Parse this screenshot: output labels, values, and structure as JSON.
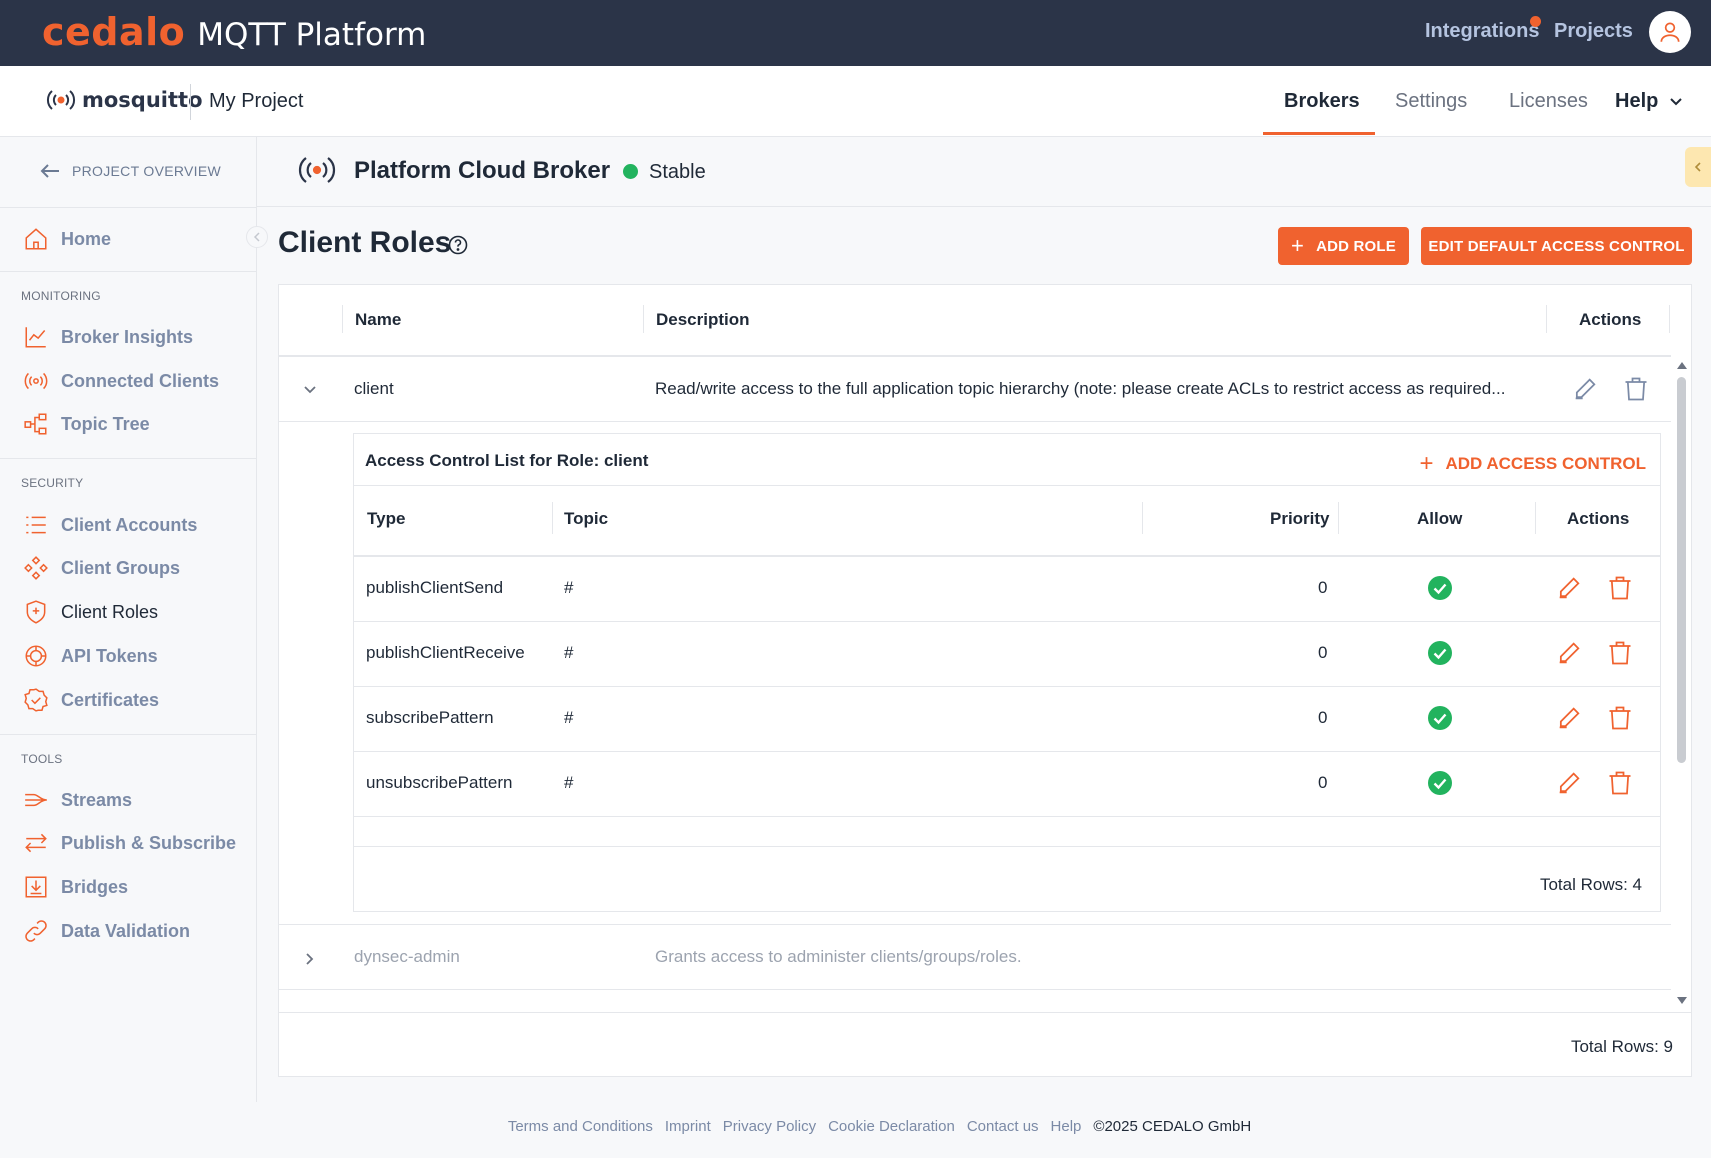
{
  "topbar": {
    "brand": "cedalo",
    "product": "MQTT Platform",
    "integrations": "Integrations",
    "projects": "Projects"
  },
  "subbar": {
    "logo_text": "mosquitto",
    "project_name": "My Project",
    "tabs": [
      "Brokers",
      "Settings",
      "Licenses",
      "Help"
    ],
    "active_tab": "Brokers"
  },
  "sidebar": {
    "project_overview": "PROJECT OVERVIEW",
    "home": "Home",
    "sections": {
      "monitoring": "MONITORING",
      "security": "SECURITY",
      "tools": "TOOLS"
    },
    "monitoring_items": [
      "Broker Insights",
      "Connected Clients",
      "Topic Tree"
    ],
    "security_items": [
      "Client Accounts",
      "Client Groups",
      "Client Roles",
      "API Tokens",
      "Certificates"
    ],
    "tools_items": [
      "Streams",
      "Publish & Subscribe",
      "Bridges",
      "Data Validation"
    ],
    "active_item": "Client Roles"
  },
  "broker": {
    "name": "Platform Cloud Broker",
    "status": "Stable",
    "status_color": "#22b35e"
  },
  "page": {
    "title": "Client Roles",
    "add_role_label": "ADD ROLE",
    "edit_default_label": "EDIT DEFAULT ACCESS CONTROL"
  },
  "roles_table": {
    "headers": [
      "Name",
      "Description",
      "Actions"
    ],
    "rows": [
      {
        "name": "client",
        "description": "Read/write access to the full application topic hierarchy (note: please create ACLs to restrict access as required...",
        "expanded": true
      },
      {
        "name": "dynsec-admin",
        "description": "Grants access to administer clients/groups/roles.",
        "expanded": false
      }
    ],
    "total_rows": "Total Rows: 9"
  },
  "acl": {
    "title": "Access Control List for Role: client",
    "add_label": "ADD ACCESS CONTROL",
    "headers": [
      "Type",
      "Topic",
      "Priority",
      "Allow",
      "Actions"
    ],
    "rows": [
      {
        "type": "publishClientSend",
        "topic": "#",
        "priority": "0",
        "allow": true
      },
      {
        "type": "publishClientReceive",
        "topic": "#",
        "priority": "0",
        "allow": true
      },
      {
        "type": "subscribePattern",
        "topic": "#",
        "priority": "0",
        "allow": true
      },
      {
        "type": "unsubscribePattern",
        "topic": "#",
        "priority": "0",
        "allow": true
      }
    ],
    "total_rows": "Total Rows: 4"
  },
  "footer": {
    "links": [
      "Terms and Conditions",
      "Imprint",
      "Privacy Policy",
      "Cookie Declaration",
      "Contact us",
      "Help"
    ],
    "copyright": "©2025 CEDALO GmbH"
  },
  "colors": {
    "accent": "#f0622f",
    "topbar": "#2b3448",
    "success": "#22b35e"
  }
}
